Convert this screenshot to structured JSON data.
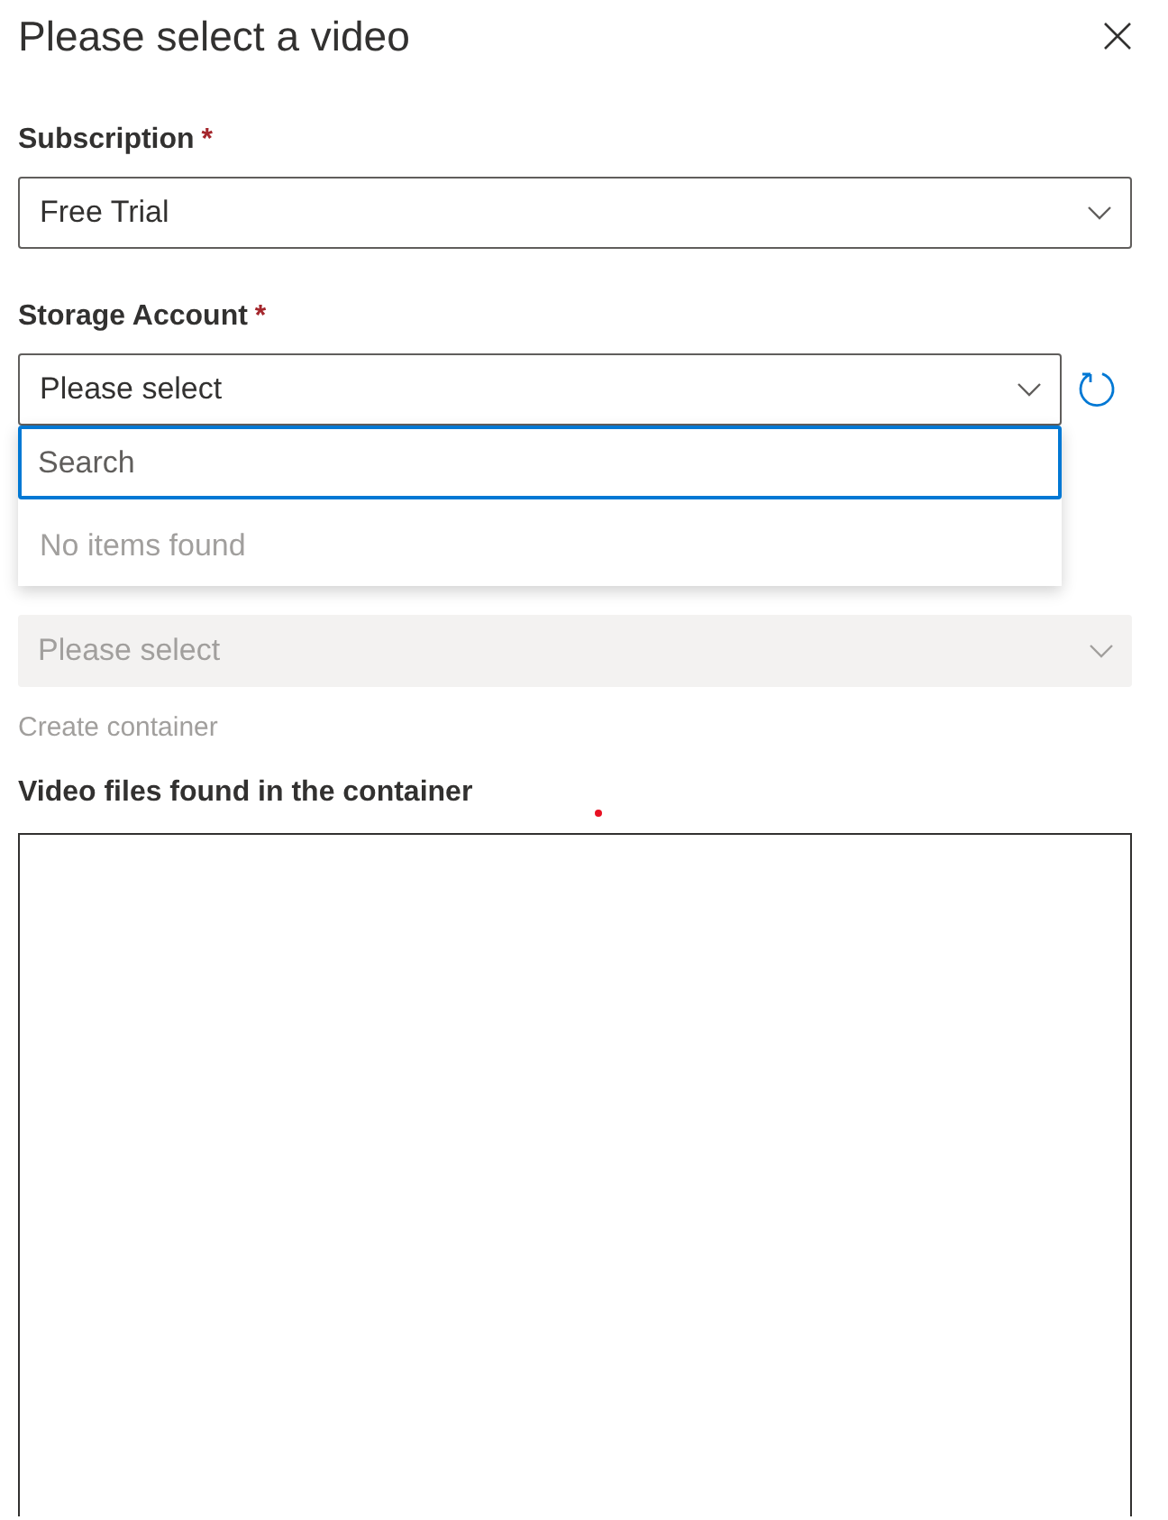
{
  "dialog": {
    "title": "Please select a video"
  },
  "fields": [
    {
      "kind": "select",
      "label": "Subscription",
      "required_mark": "*",
      "value": "Free Trial"
    },
    {
      "kind": "select",
      "label": "Storage Account",
      "required_mark": "*",
      "value": "Please select",
      "refresh": true,
      "expanded": true,
      "search_placeholder": "Search",
      "empty_text": "No items found"
    },
    {
      "kind": "select",
      "value": "Please select",
      "disabled": true
    },
    {
      "kind": "link",
      "text": "Create container",
      "disabled": true
    },
    {
      "kind": "list",
      "label": "Video files found in the container"
    }
  ]
}
